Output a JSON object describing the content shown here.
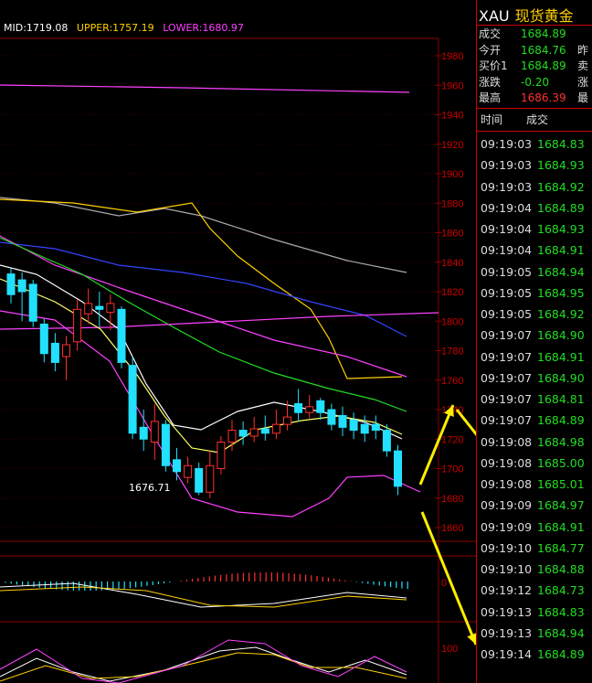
{
  "header": {
    "mid_label": "MID:1719.08",
    "upper_label": "UPPER:1757.19",
    "lower_label": "LOWER:1680.97"
  },
  "colors": {
    "up": "#ff3030",
    "down": "#22e0ff",
    "mid": "#ffffff",
    "upper": "#ffd000",
    "lower": "#ff40ff",
    "gain": "#22dd22",
    "grid": "#8a0000"
  },
  "chart": {
    "price_axis": [
      "1980",
      "1960",
      "1940",
      "1920",
      "1900",
      "1880",
      "1860",
      "1840",
      "1820",
      "1800",
      "1780",
      "1760",
      "1740",
      "1720",
      "1700",
      "1680",
      "1660"
    ],
    "low_marker": "1676.71",
    "macd_axis": "0",
    "kdj_axis": "100"
  },
  "quote": {
    "symbol": "XAU",
    "name": "现货黄金",
    "rows": [
      {
        "label": "成交",
        "value": "1684.89",
        "color": "#22dd22",
        "extra": ""
      },
      {
        "label": "今开",
        "value": "1684.76",
        "color": "#22dd22",
        "extra": "昨"
      },
      {
        "label": "买价1",
        "value": "1684.89",
        "color": "#22dd22",
        "extra": "卖"
      },
      {
        "label": "涨跌",
        "value": "-0.20",
        "color": "#22dd22",
        "extra": "涨"
      },
      {
        "label": "最高",
        "value": "1686.39",
        "color": "#ff3030",
        "extra": "最"
      }
    ]
  },
  "ticks": {
    "header": [
      "时间",
      "成交"
    ],
    "rows": [
      {
        "time": "09:19:03",
        "price": "1684.83"
      },
      {
        "time": "09:19:03",
        "price": "1684.93"
      },
      {
        "time": "09:19:03",
        "price": "1684.92"
      },
      {
        "time": "09:19:04",
        "price": "1684.89"
      },
      {
        "time": "09:19:04",
        "price": "1684.93"
      },
      {
        "time": "09:19:04",
        "price": "1684.91"
      },
      {
        "time": "09:19:05",
        "price": "1684.94"
      },
      {
        "time": "09:19:05",
        "price": "1684.95"
      },
      {
        "time": "09:19:05",
        "price": "1684.92"
      },
      {
        "time": "09:19:07",
        "price": "1684.90"
      },
      {
        "time": "09:19:07",
        "price": "1684.91"
      },
      {
        "time": "09:19:07",
        "price": "1684.90"
      },
      {
        "time": "09:19:07",
        "price": "1684.81"
      },
      {
        "time": "09:19:07",
        "price": "1684.89"
      },
      {
        "time": "09:19:08",
        "price": "1684.98"
      },
      {
        "time": "09:19:08",
        "price": "1685.00"
      },
      {
        "time": "09:19:08",
        "price": "1685.01"
      },
      {
        "time": "09:19:09",
        "price": "1684.97"
      },
      {
        "time": "09:19:09",
        "price": "1684.91"
      },
      {
        "time": "09:19:10",
        "price": "1684.77"
      },
      {
        "time": "09:19:10",
        "price": "1684.88"
      },
      {
        "time": "09:19:12",
        "price": "1684.73"
      },
      {
        "time": "09:19:13",
        "price": "1684.83"
      },
      {
        "time": "09:19:13",
        "price": "1684.94"
      },
      {
        "time": "09:19:14",
        "price": "1684.89"
      }
    ]
  },
  "candles": [
    {
      "o": 1832,
      "c": 1818,
      "h": 1836,
      "l": 1812
    },
    {
      "o": 1828,
      "c": 1820,
      "h": 1833,
      "l": 1800
    },
    {
      "o": 1825,
      "c": 1800,
      "h": 1828,
      "l": 1796
    },
    {
      "o": 1798,
      "c": 1778,
      "h": 1802,
      "l": 1772
    },
    {
      "o": 1785,
      "c": 1772,
      "h": 1792,
      "l": 1766
    },
    {
      "o": 1776,
      "c": 1784,
      "h": 1790,
      "l": 1760
    },
    {
      "o": 1786,
      "c": 1808,
      "h": 1815,
      "l": 1780
    },
    {
      "o": 1805,
      "c": 1812,
      "h": 1822,
      "l": 1798
    },
    {
      "o": 1810,
      "c": 1808,
      "h": 1820,
      "l": 1796
    },
    {
      "o": 1806,
      "c": 1812,
      "h": 1818,
      "l": 1794
    },
    {
      "o": 1808,
      "c": 1772,
      "h": 1810,
      "l": 1768
    },
    {
      "o": 1770,
      "c": 1724,
      "h": 1776,
      "l": 1720
    },
    {
      "o": 1728,
      "c": 1720,
      "h": 1740,
      "l": 1712
    },
    {
      "o": 1718,
      "c": 1732,
      "h": 1744,
      "l": 1706
    },
    {
      "o": 1730,
      "c": 1702,
      "h": 1733,
      "l": 1698
    },
    {
      "o": 1706,
      "c": 1698,
      "h": 1714,
      "l": 1692
    },
    {
      "o": 1694,
      "c": 1702,
      "h": 1708,
      "l": 1690
    },
    {
      "o": 1700,
      "c": 1684,
      "h": 1704,
      "l": 1682
    },
    {
      "o": 1684,
      "c": 1702,
      "h": 1712,
      "l": 1680
    },
    {
      "o": 1700,
      "c": 1718,
      "h": 1722,
      "l": 1696
    },
    {
      "o": 1718,
      "c": 1726,
      "h": 1733,
      "l": 1712
    },
    {
      "o": 1726,
      "c": 1722,
      "h": 1732,
      "l": 1716
    },
    {
      "o": 1722,
      "c": 1727,
      "h": 1735,
      "l": 1718
    },
    {
      "o": 1727,
      "c": 1724,
      "h": 1736,
      "l": 1719
    },
    {
      "o": 1724,
      "c": 1730,
      "h": 1740,
      "l": 1720
    },
    {
      "o": 1730,
      "c": 1735,
      "h": 1746,
      "l": 1726
    },
    {
      "o": 1744,
      "c": 1738,
      "h": 1754,
      "l": 1732
    },
    {
      "o": 1738,
      "c": 1742,
      "h": 1750,
      "l": 1734
    },
    {
      "o": 1746,
      "c": 1738,
      "h": 1748,
      "l": 1733
    },
    {
      "o": 1740,
      "c": 1730,
      "h": 1744,
      "l": 1726
    },
    {
      "o": 1736,
      "c": 1728,
      "h": 1742,
      "l": 1722
    },
    {
      "o": 1733,
      "c": 1726,
      "h": 1738,
      "l": 1720
    },
    {
      "o": 1730,
      "c": 1724,
      "h": 1736,
      "l": 1718
    },
    {
      "o": 1730,
      "c": 1726,
      "h": 1736,
      "l": 1720
    },
    {
      "o": 1726,
      "c": 1712,
      "h": 1730,
      "l": 1708
    },
    {
      "o": 1712,
      "c": 1688,
      "h": 1716,
      "l": 1682
    }
  ]
}
